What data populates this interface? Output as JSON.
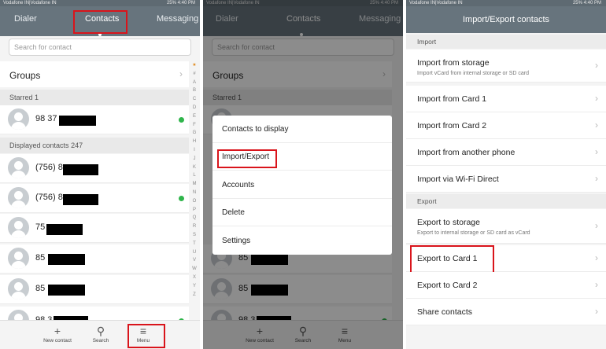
{
  "status_bar": {
    "carrier": "Vodafone IN|Vodafone IN",
    "right": "25% 4:40 PM"
  },
  "tabs": [
    "Dialer",
    "Contacts",
    "Messaging"
  ],
  "search": {
    "placeholder": "Search for contact"
  },
  "groups_label": "Groups",
  "starred": {
    "label": "Starred",
    "count": "1"
  },
  "displayed": {
    "label": "Displayed contacts",
    "count": "247"
  },
  "contacts": [
    {
      "name": "98 37",
      "whatsapp": true
    },
    {
      "name": "(756) 8",
      "whatsapp": false
    },
    {
      "name": "(756) 8",
      "whatsapp": true
    },
    {
      "name": "75",
      "whatsapp": false
    },
    {
      "name": "85",
      "whatsapp": false
    },
    {
      "name": "85",
      "whatsapp": false
    },
    {
      "name": "98 3",
      "whatsapp": true
    }
  ],
  "alphabet": [
    "★",
    "#",
    "A",
    "B",
    "C",
    "D",
    "E",
    "F",
    "G",
    "H",
    "I",
    "J",
    "K",
    "L",
    "M",
    "N",
    "O",
    "P",
    "Q",
    "R",
    "S",
    "T",
    "U",
    "V",
    "W",
    "X",
    "Y",
    "Z"
  ],
  "bottom_nav": {
    "new_contact": "New contact",
    "search": "Search",
    "menu": "Menu"
  },
  "menu": {
    "items": [
      "Contacts to display",
      "Import/Export",
      "Accounts",
      "Delete",
      "Settings"
    ]
  },
  "import_export": {
    "title": "Import/Export contacts",
    "import_section": "Import",
    "import_items": [
      {
        "label": "Import from storage",
        "sub": "Import vCard from internal storage or SD card"
      },
      {
        "label": "Import from Card 1",
        "sub": ""
      },
      {
        "label": "Import from Card 2",
        "sub": ""
      },
      {
        "label": "Import from another phone",
        "sub": ""
      },
      {
        "label": "Import via Wi-Fi Direct",
        "sub": ""
      }
    ],
    "export_section": "Export",
    "export_items": [
      {
        "label": "Export to storage",
        "sub": "Export to internal storage or SD card as vCard"
      },
      {
        "label": "Export to Card 1",
        "sub": ""
      },
      {
        "label": "Export to Card 2",
        "sub": ""
      },
      {
        "label": "Share contacts",
        "sub": ""
      }
    ]
  },
  "colors": {
    "accent": "#67747d",
    "highlight": "#d9141b",
    "whatsapp": "#2fb54b"
  },
  "icons": {
    "chevron": "chevron-right-icon",
    "plus": "plus-icon",
    "search": "search-icon",
    "menu": "hamburger-menu-icon"
  }
}
